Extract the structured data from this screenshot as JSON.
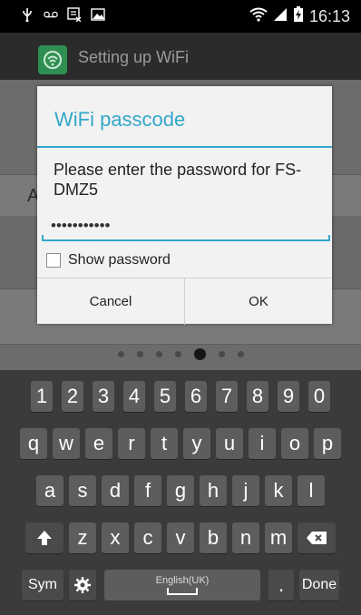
{
  "status_bar": {
    "time": "16:13",
    "icons_left": [
      "usb-icon",
      "voicemail-icon",
      "app-notification-icon",
      "image-icon"
    ],
    "icons_right": [
      "wifi-icon",
      "signal-icon",
      "battery-charging-icon"
    ]
  },
  "action_bar": {
    "title": "Setting up WiFi",
    "app_icon": "wifi-setup-app-icon",
    "icon_color": "#2f8f52"
  },
  "background_content": {
    "partial_letter": "A"
  },
  "dialog": {
    "title": "WiFi passcode",
    "message": "Please enter the password for FS-DMZ5",
    "password_value": "•••••••••••",
    "show_password_label": "Show password",
    "show_password_checked": false,
    "cancel_label": "Cancel",
    "ok_label": "OK",
    "accent_color": "#33a7c9"
  },
  "page_indicator": {
    "count": 7,
    "active_index": 4
  },
  "keyboard": {
    "number_row": [
      "1",
      "2",
      "3",
      "4",
      "5",
      "6",
      "7",
      "8",
      "9",
      "0"
    ],
    "row1": [
      "q",
      "w",
      "e",
      "r",
      "t",
      "y",
      "u",
      "i",
      "o",
      "p"
    ],
    "row2": [
      "a",
      "s",
      "d",
      "f",
      "g",
      "h",
      "j",
      "k",
      "l"
    ],
    "row3": [
      "z",
      "x",
      "c",
      "v",
      "b",
      "n",
      "m"
    ],
    "sym_label": "Sym",
    "space_label": "English(UK)",
    "period_label": ".",
    "done_label": "Done"
  }
}
